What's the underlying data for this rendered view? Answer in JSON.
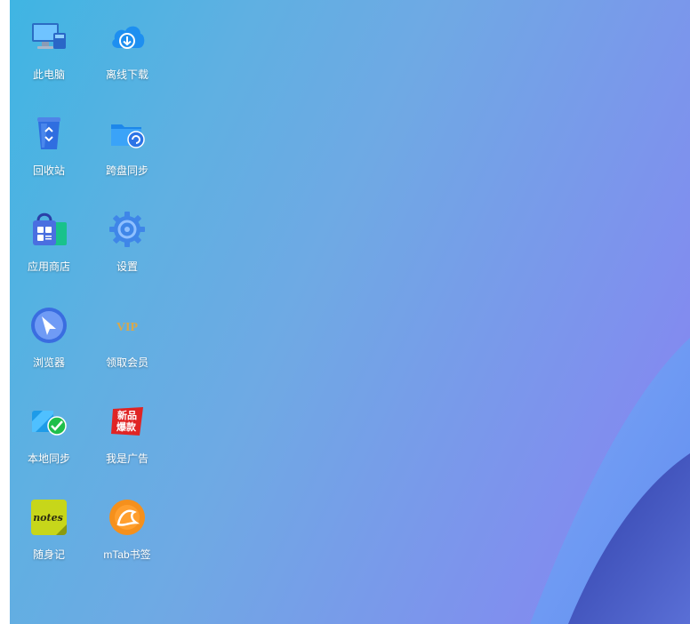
{
  "desktop": {
    "icons": [
      {
        "label": "此电脑",
        "icon": "computer-icon"
      },
      {
        "label": "离线下载",
        "icon": "cloud-download-icon"
      },
      {
        "label": "回收站",
        "icon": "recycle-bin-icon"
      },
      {
        "label": "跨盘同步",
        "icon": "folder-sync-icon"
      },
      {
        "label": "应用商店",
        "icon": "app-store-bag-icon"
      },
      {
        "label": "设置",
        "icon": "gear-icon"
      },
      {
        "label": "浏览器",
        "icon": "browser-compass-icon"
      },
      {
        "label": "领取会员",
        "icon": "vip-icon"
      },
      {
        "label": "本地同步",
        "icon": "local-sync-check-icon"
      },
      {
        "label": "我是广告",
        "icon": "ad-badge-icon"
      },
      {
        "label": "随身记",
        "icon": "notes-icon"
      },
      {
        "label": "mTab书签",
        "icon": "mtab-bookmark-icon"
      }
    ],
    "vip_text": "VIP",
    "ad_badge_text": [
      "新品",
      "爆款"
    ],
    "notes_text": "notes",
    "colors": {
      "wallpaper_start": "#3fb5e3",
      "wallpaper_end": "#8a7ff2",
      "wave_light": "#6f9cf5",
      "wave_dark": "#3a4fbf",
      "label_text": "#ffffff"
    }
  }
}
